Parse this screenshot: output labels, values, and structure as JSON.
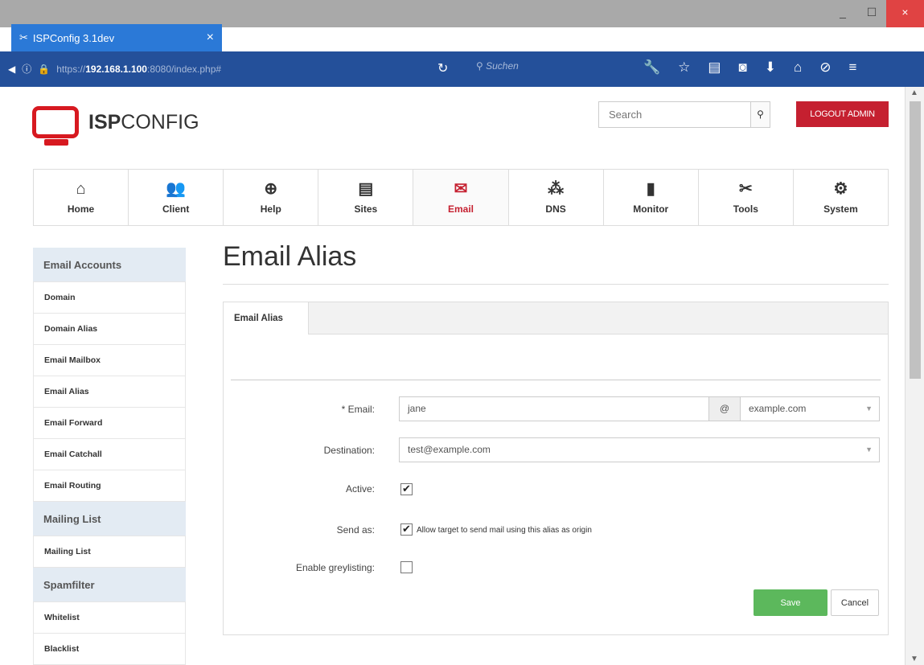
{
  "browser": {
    "tab_title": "ISPConfig 3.1dev",
    "tab_close": "×",
    "new_tab": "+",
    "url_scheme": "https://",
    "url_host": "192.168.1.100",
    "url_rest": ":8080/index.php#",
    "search_placeholder": "Suchen",
    "window_controls": {
      "minimize": "_",
      "maximize": "☐",
      "close": "×"
    }
  },
  "header": {
    "logo_bold": "ISP",
    "logo_light": "CONFIG",
    "search_placeholder": "Search",
    "logout_label": "LOGOUT ADMIN"
  },
  "modules": [
    {
      "label": "Home",
      "icon": "home-icon",
      "glyph": "⌂",
      "active": false
    },
    {
      "label": "Client",
      "icon": "client-icon",
      "glyph": "👥",
      "active": false
    },
    {
      "label": "Help",
      "icon": "help-icon",
      "glyph": "⊕",
      "active": false
    },
    {
      "label": "Sites",
      "icon": "sites-icon",
      "glyph": "▤",
      "active": false
    },
    {
      "label": "Email",
      "icon": "email-icon",
      "glyph": "✉",
      "active": true
    },
    {
      "label": "DNS",
      "icon": "dns-icon",
      "glyph": "⁂",
      "active": false
    },
    {
      "label": "Monitor",
      "icon": "monitor-icon",
      "glyph": "▮",
      "active": false
    },
    {
      "label": "Tools",
      "icon": "tools-icon",
      "glyph": "✂",
      "active": false
    },
    {
      "label": "System",
      "icon": "system-icon",
      "glyph": "⚙",
      "active": false
    }
  ],
  "sidebar": {
    "section1": "Email Accounts",
    "section1_items": [
      "Domain",
      "Domain Alias",
      "Email Mailbox",
      "Email Alias",
      "Email Forward",
      "Email Catchall",
      "Email Routing"
    ],
    "section2": "Mailing List",
    "section2_items": [
      "Mailing List"
    ],
    "section3": "Spamfilter",
    "section3_items": [
      "Whitelist",
      "Blacklist"
    ]
  },
  "main": {
    "title": "Email Alias",
    "tab_label": "Email Alias",
    "form": {
      "email_label": "* Email:",
      "email_value": "jane",
      "at_sign": "@",
      "domain_value": "example.com",
      "destination_label": "Destination:",
      "destination_value": "test@example.com",
      "active_label": "Active:",
      "active_checked": true,
      "sendas_label": "Send as:",
      "sendas_checked": true,
      "sendas_text": "Allow target to send mail using this alias as origin",
      "greylisting_label": "Enable greylisting:",
      "greylisting_checked": false
    },
    "save_label": "Save",
    "cancel_label": "Cancel"
  },
  "colors": {
    "accent_red": "#c52030",
    "save_green": "#5cb85c",
    "browser_blue": "#24509a"
  }
}
